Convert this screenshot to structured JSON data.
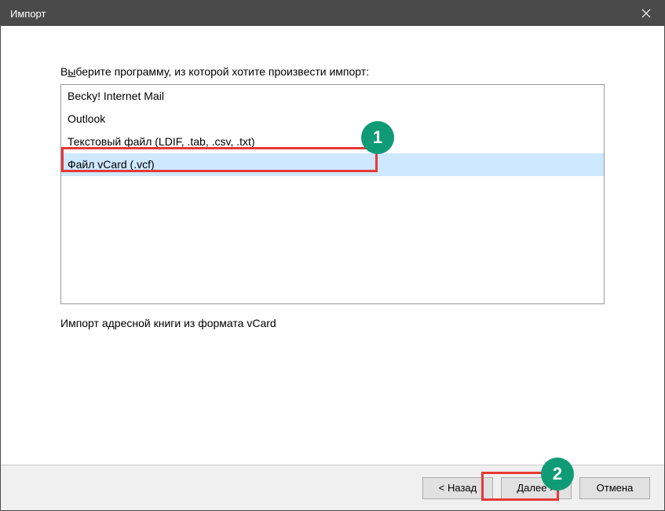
{
  "window": {
    "title": "Импорт"
  },
  "prompt": {
    "prefix": "В",
    "mnemonic": "ы",
    "suffix": "берите программу, из которой хотите произвести импорт:"
  },
  "items": [
    {
      "label": "Becky! Internet Mail",
      "selected": false
    },
    {
      "label": "Outlook",
      "selected": false
    },
    {
      "label": "Текстовый файл (LDIF, .tab, .csv, .txt)",
      "selected": false
    },
    {
      "label": "Файл vCard (.vcf)",
      "selected": true
    }
  ],
  "description": "Импорт адресной книги из формата vCard",
  "buttons": {
    "back": "< Назад",
    "next": "Далее >",
    "cancel": "Отмена"
  },
  "annotations": {
    "one": "1",
    "two": "2"
  }
}
